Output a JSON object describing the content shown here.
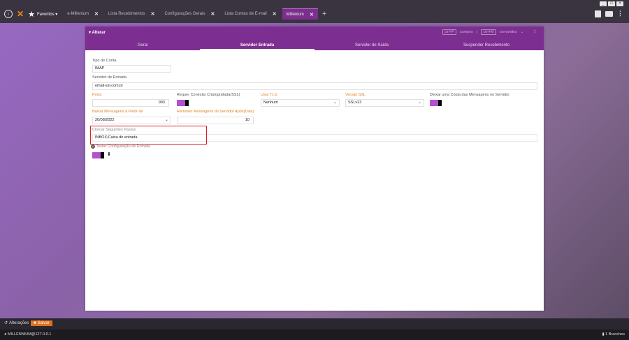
{
  "window": {
    "controls": [
      "_",
      "□",
      "×"
    ]
  },
  "tabbar": {
    "favorites_label": "Favoritos ▾",
    "tabs": [
      {
        "label": "e-Millenium",
        "active": false
      },
      {
        "label": "Lista Recebimentos",
        "active": false
      },
      {
        "label": "Configurações Gerais",
        "active": false
      },
      {
        "label": "Lista Contas de E-mail",
        "active": false
      },
      {
        "label": "Millenium",
        "active": true
      }
    ],
    "close_glyph": "✕",
    "add_glyph": "+"
  },
  "panel": {
    "title": "▾ Alterar",
    "kbd1": "ctrl+F",
    "kbd1_text": "campos",
    "separator": "|",
    "kbd2": "ctrl+M",
    "kbd2_text": "comandos",
    "menu_glyph": "⋮",
    "tabs": [
      {
        "label": "Geral",
        "active": false
      },
      {
        "label": "Servidor Entrada",
        "active": true
      },
      {
        "label": "Servidor de Saída",
        "active": false
      },
      {
        "label": "Suspender Recebimento",
        "active": false
      }
    ]
  },
  "form": {
    "tipo_conta_label": "Tipo de Conta",
    "tipo_conta_value": "IMAP",
    "servidor_entrada_label": "Servidor de Entrada",
    "servidor_entrada_value": "email-ssl.com.br",
    "porta_label": "Porta",
    "porta_value": "993",
    "requer_ssl_label": "Requer Conexão Criptografada(SSL)",
    "usar_tls_label": "Usar TLS",
    "usar_tls_value": "Nenhum",
    "versao_ssl_label": "Versão SSL",
    "versao_ssl_value": "SSLv23",
    "deixar_copia_label": "Deixar uma Cópia das Mensagens no Servidor",
    "baixar_label": "Baixar Mensagens à Partir de",
    "baixar_value": "20/08/2022",
    "remover_label": "Remover Mensagens do Servidor Após(Dias)",
    "remover_value": "10",
    "checar_label": "Checar Seguintes Pastas",
    "checar_value": "INBOX;Caixa de entrada",
    "testar_label": "Testar Configuração de Entrada"
  },
  "actions": {
    "alteracoes": "Alterações",
    "salvar": "Salvar"
  },
  "status": {
    "left": "MILLENNIUM@127.0.0.1",
    "right": "1 Branches"
  },
  "colors": {
    "accent": "#7d2e91",
    "toggle": "#b350cf",
    "highlight": "#d8202a",
    "orange": "#e2801e"
  }
}
